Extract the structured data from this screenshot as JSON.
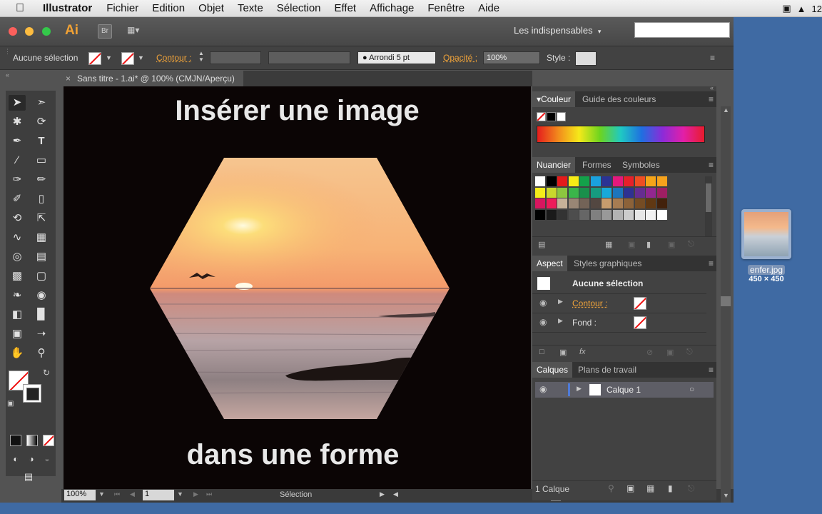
{
  "menubar": {
    "app": "Illustrator",
    "items": [
      "Fichier",
      "Edition",
      "Objet",
      "Texte",
      "Sélection",
      "Effet",
      "Affichage",
      "Fenêtre",
      "Aide"
    ],
    "clock_partial": "12"
  },
  "window": {
    "logo": "Ai",
    "bridge_label": "Br",
    "workspace": "Les indispensables",
    "search_placeholder": ""
  },
  "control_bar": {
    "selection": "Aucune sélection",
    "stroke_label": "Contour :",
    "brush": "Arrondi 5 pt",
    "opacity_label": "Opacité :",
    "opacity_value": "100%",
    "style_label": "Style :"
  },
  "document": {
    "tab_title": "Sans titre - 1.ai* @ 100% (CMJN/Aperçu)",
    "artboard_title": "Insérer une image",
    "artboard_subtitle": "dans une forme"
  },
  "status_bar": {
    "zoom": "100%",
    "page": "1",
    "mode": "Sélection"
  },
  "panels": {
    "couleur_tabs": [
      "Couleur",
      "Guide des couleurs"
    ],
    "nuancier_tabs": [
      "Nuancier",
      "Formes",
      "Symboles"
    ],
    "aspect_tabs": [
      "Aspect",
      "Styles graphiques"
    ],
    "aspect_header": "Aucune sélection",
    "aspect_rows": [
      "Contour :",
      "Fond :"
    ],
    "calques_tabs": [
      "Calques",
      "Plans de travail"
    ],
    "layer_name": "Calque 1",
    "layer_count": "1 Calque"
  },
  "desktop": {
    "file_name": "enfer.jpg",
    "file_dims": "450 × 450"
  },
  "colors": {
    "accent_orange": "#f0a33a",
    "panel_bg": "#424242",
    "artboard_bg": "#0b0505",
    "desktop_bg": "#3f6aa3"
  },
  "swatch_colors": [
    "#ffffff",
    "#000000",
    "#e41b1b",
    "#f7ec16",
    "#13a14a",
    "#1aa1de",
    "#2b3394",
    "#e4197d",
    "#e7202a",
    "#ef4e23",
    "#f5a418",
    "#f6a21c",
    "#f5ec1a",
    "#c9d82c",
    "#8cc63f",
    "#3ab54a",
    "#19904b",
    "#169b7f",
    "#18a9d9",
    "#1c75bc",
    "#2e3192",
    "#662d91",
    "#92278f",
    "#9e1f63",
    "#d7165f",
    "#ed1c5a",
    "#c7b299",
    "#998675",
    "#736357",
    "#534741",
    "#c69c6d",
    "#a67c52",
    "#8c6239",
    "#754c24",
    "#603813",
    "#42210b",
    "#000000",
    "#1a1a1a",
    "#333333",
    "#4d4d4d",
    "#666666",
    "#808080",
    "#999999",
    "#b3b3b3",
    "#cccccc",
    "#e6e6e6",
    "#f2f2f2",
    "#ffffff"
  ]
}
